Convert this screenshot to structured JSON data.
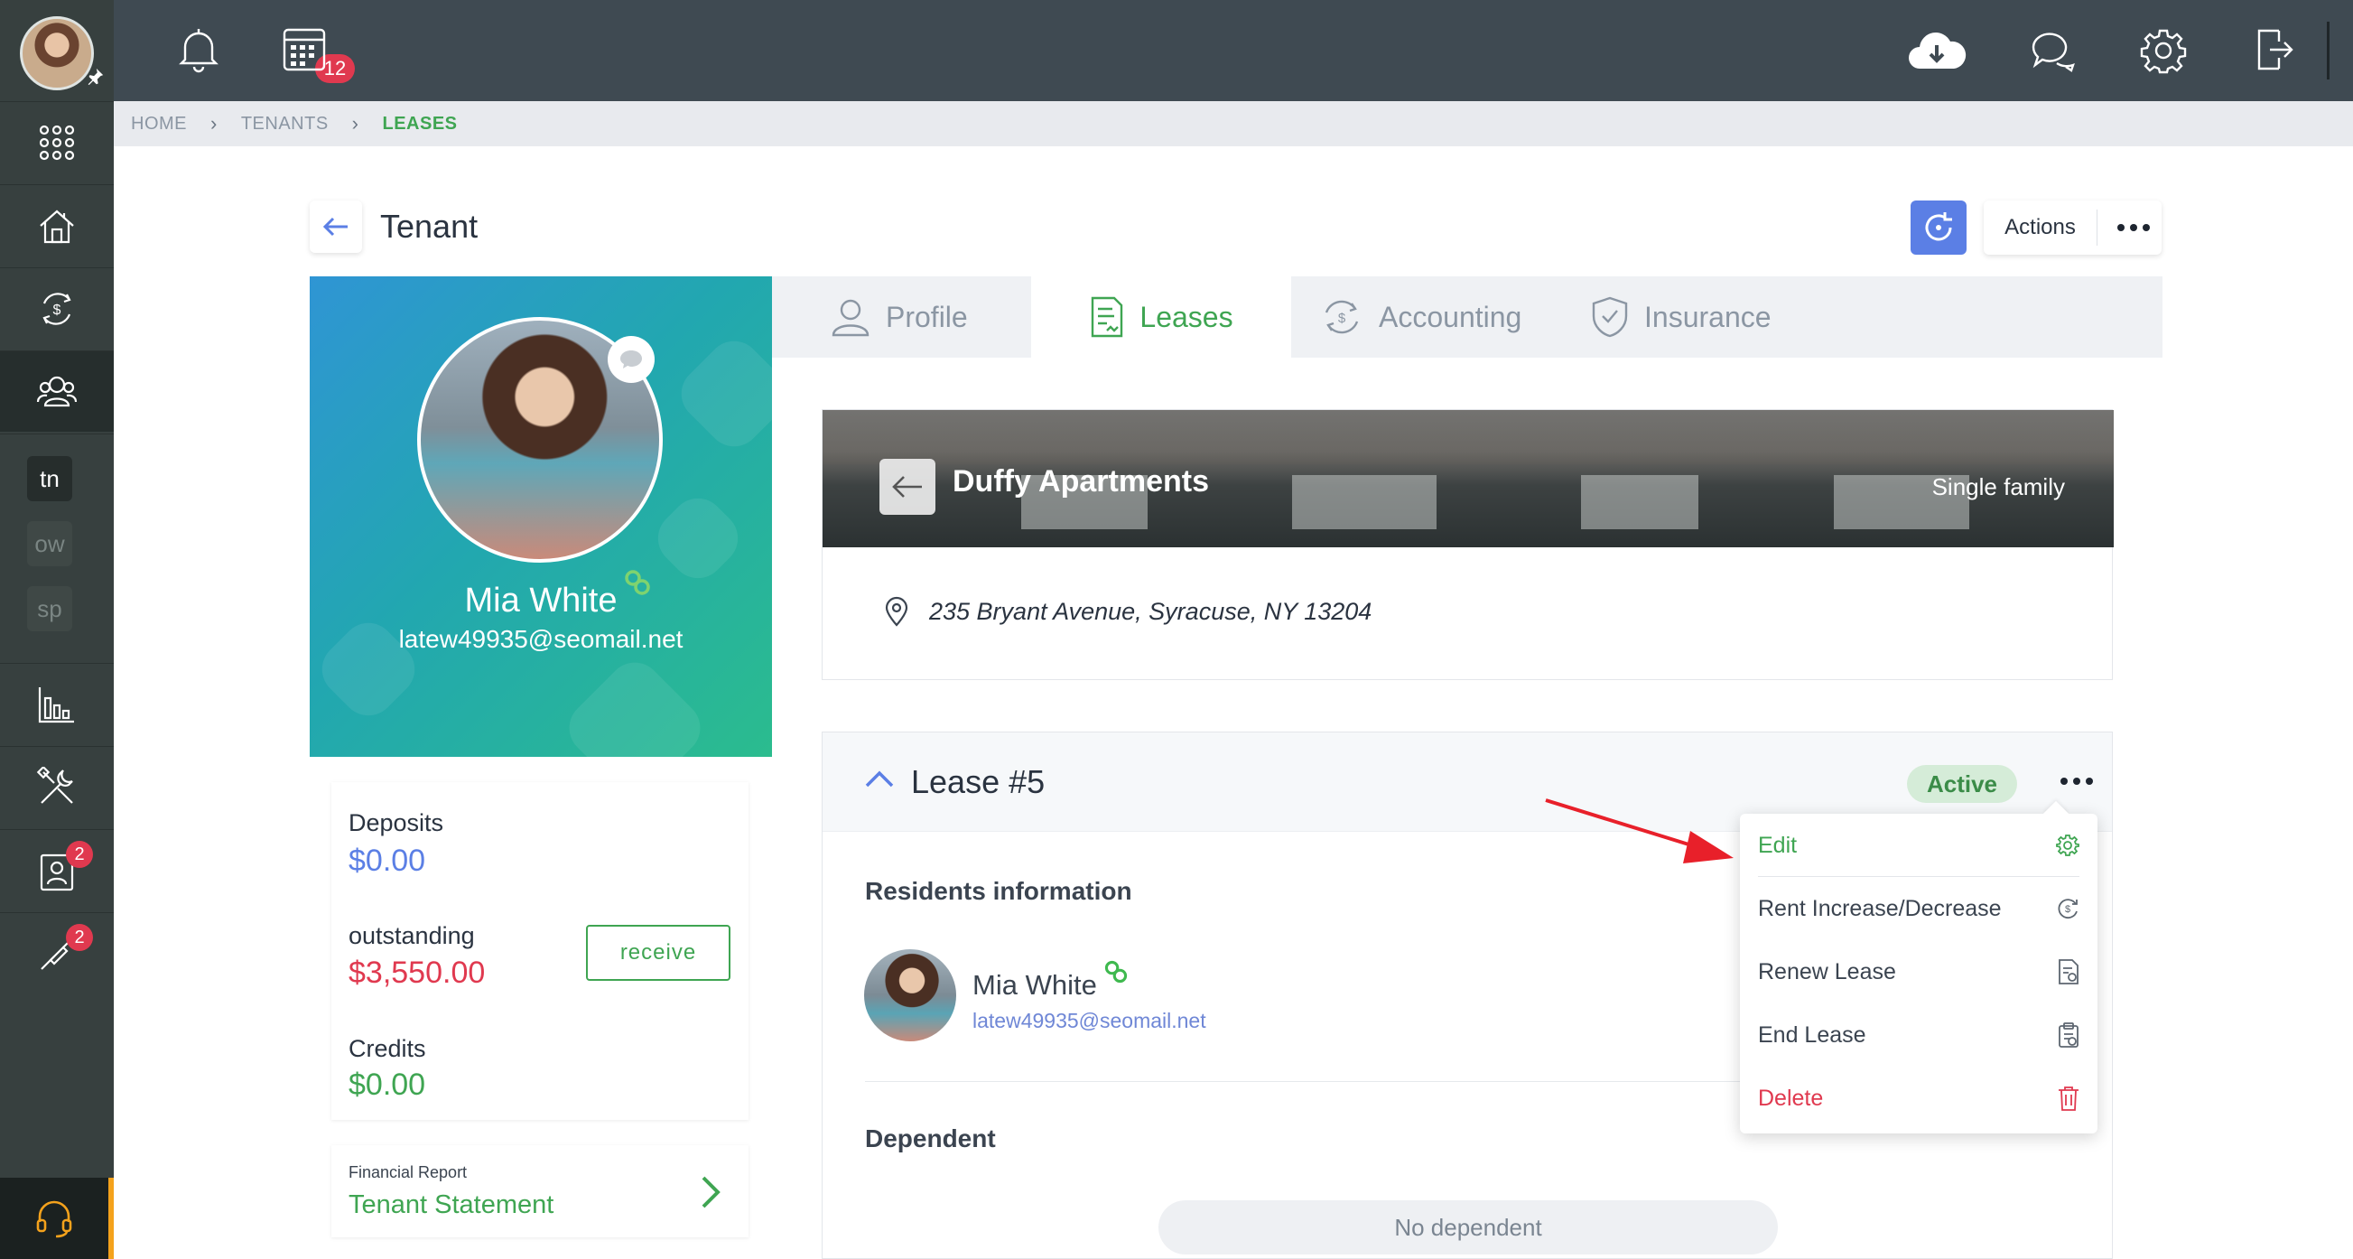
{
  "topbar": {
    "notifications_count": "12"
  },
  "sidebar": {
    "items": [
      {
        "icon": "apps-grid-icon"
      },
      {
        "icon": "properties-icon"
      },
      {
        "icon": "accounting-icon"
      },
      {
        "icon": "people-icon"
      },
      {
        "label": "tn"
      },
      {
        "label": "ow"
      },
      {
        "label": "sp"
      },
      {
        "icon": "reports-icon"
      },
      {
        "icon": "maintenance-icon"
      },
      {
        "icon": "contacts-icon",
        "badge": "2"
      },
      {
        "icon": "tools-icon",
        "badge": "2"
      }
    ]
  },
  "breadcrumb": {
    "items": [
      "HOME",
      "TENANTS",
      "LEASES"
    ]
  },
  "page": {
    "title": "Tenant",
    "actions_label": "Actions"
  },
  "tenant": {
    "name": "Mia White",
    "email": "latew49935@seomail.net"
  },
  "balances": {
    "deposits_label": "Deposits",
    "deposits_value": "$0.00",
    "outstanding_label": "outstanding",
    "outstanding_value": "$3,550.00",
    "receive_label": "receive",
    "credits_label": "Credits",
    "credits_value": "$0.00"
  },
  "financial_report": {
    "caption": "Financial Report",
    "link": "Tenant Statement"
  },
  "tabs": [
    {
      "label": "Profile",
      "icon": "user-icon"
    },
    {
      "label": "Leases",
      "icon": "lease-document-icon"
    },
    {
      "label": "Accounting",
      "icon": "accounting-icon"
    },
    {
      "label": "Insurance",
      "icon": "shield-icon"
    }
  ],
  "property": {
    "name": "Duffy Apartments",
    "type": "Single family",
    "address": "235 Bryant Avenue, Syracuse, NY 13204"
  },
  "lease": {
    "title": "Lease #5",
    "status": "Active",
    "residents_title": "Residents information",
    "resident_name": "Mia White",
    "resident_email": "latew49935@seomail.net",
    "dependent_title": "Dependent",
    "no_dependent": "No dependent"
  },
  "lease_menu": {
    "items": [
      {
        "label": "Edit",
        "icon": "gear-icon"
      },
      {
        "label": "Rent Increase/Decrease",
        "icon": "rent-change-icon"
      },
      {
        "label": "Renew Lease",
        "icon": "renew-document-icon"
      },
      {
        "label": "End Lease",
        "icon": "end-lease-icon"
      },
      {
        "label": "Delete",
        "icon": "trash-icon"
      }
    ]
  },
  "colors": {
    "accent_green": "#3fa552",
    "danger_red": "#e0394f",
    "primary_blue": "#5b7fe5",
    "sidebar": "#37403f",
    "topbar": "#3f4a52"
  }
}
